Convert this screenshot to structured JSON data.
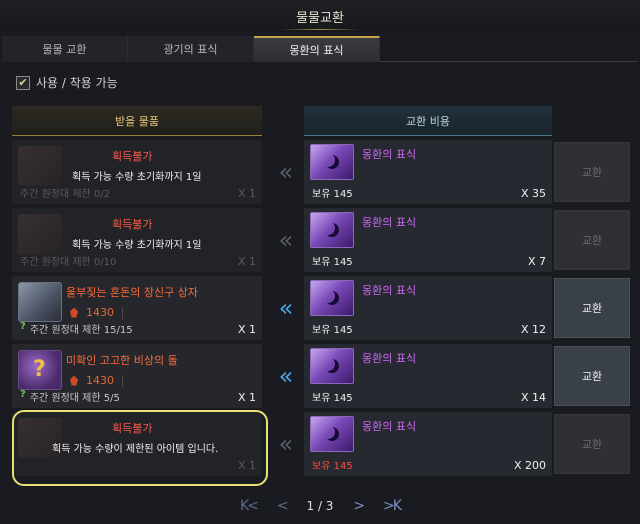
{
  "window": {
    "title": "물물교환"
  },
  "tabs": [
    {
      "label": "물물 교환",
      "active": false
    },
    {
      "label": "광기의 표식",
      "active": false
    },
    {
      "label": "몽환의 표식",
      "active": true
    }
  ],
  "filter": {
    "label": "사용 / 착용 가능",
    "checked": true
  },
  "columns": {
    "receive": "받을 물품",
    "cost": "교환 비용"
  },
  "rows": [
    {
      "enabled": false,
      "item_icon": "chest-icon",
      "item_name": "",
      "unavailable": "획득불가",
      "tooltip": "획득 가능 수량 초기화까지 1일",
      "price": "",
      "weekly_label": "주간 원정대 제한 0/2",
      "receive_qty": "X 1",
      "cost_name": "몽환의 표식",
      "owned": "보유 145",
      "cost_qty": "X 35",
      "button": "교환"
    },
    {
      "enabled": false,
      "item_icon": "chest-icon",
      "item_name": "",
      "unavailable": "획득불가",
      "tooltip": "획득 가능 수량 초기화까지 1일",
      "price": "",
      "weekly_label": "주간 원정대 제한 0/10",
      "receive_qty": "X 1",
      "cost_name": "몽환의 표식",
      "owned": "보유 145",
      "cost_qty": "X 7",
      "button": "교환"
    },
    {
      "enabled": true,
      "item_icon": "chest-icon",
      "item_name": "울부짖는 혼돈의 장신구 상자",
      "unavailable": "",
      "tooltip": "",
      "price": "1430",
      "weekly_label": "주간 원정대 제한 15/15",
      "receive_qty": "X 1",
      "cost_name": "몽환의 표식",
      "owned": "보유 145",
      "cost_qty": "X 12",
      "button": "교환"
    },
    {
      "enabled": true,
      "item_icon": "stone-icon",
      "item_name": "미확인 고고한 비상의 돌",
      "unavailable": "",
      "tooltip": "",
      "price": "1430",
      "weekly_label": "주간 원정대 제한 5/5",
      "receive_qty": "X 1",
      "cost_name": "몽환의 표식",
      "owned": "보유 145",
      "cost_qty": "X 14",
      "button": "교환"
    },
    {
      "enabled": false,
      "item_icon": "hat-icon",
      "item_name": "",
      "unavailable": "획득불가",
      "tooltip": "획득 가능 수량이 제한된 아이템 입니다.",
      "price": "",
      "weekly_label": "",
      "receive_qty": "X 1",
      "cost_name": "몽환의 표식",
      "owned": "보유 145",
      "owned_red": true,
      "cost_qty": "X 200",
      "button": "교환"
    }
  ],
  "pagination": {
    "first": "K<",
    "prev": "<",
    "label": "1 / 3",
    "next": ">",
    "last": ">K"
  },
  "colors": {
    "gold": "#c9a24e",
    "accent_blue": "#4aa8e8",
    "warning_red": "#ff5a4a",
    "purple": "#c86af0"
  }
}
